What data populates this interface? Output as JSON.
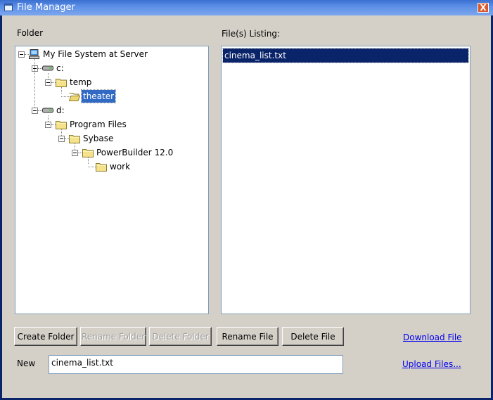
{
  "window": {
    "title": "File Manager",
    "close_label": "X"
  },
  "folder_panel": {
    "label": "Folder",
    "tree": [
      {
        "label": "My File System at Server",
        "icon": "computer-icon",
        "level": 0,
        "expanded": true,
        "selected": false
      },
      {
        "label": "c:",
        "icon": "drive-icon",
        "level": 1,
        "expanded": true,
        "selected": false
      },
      {
        "label": "temp",
        "icon": "folder-icon",
        "level": 2,
        "expanded": true,
        "selected": false
      },
      {
        "label": "theater",
        "icon": "folder-open-icon",
        "level": 3,
        "expanded": false,
        "selected": true
      },
      {
        "label": "d:",
        "icon": "drive-icon",
        "level": 1,
        "expanded": true,
        "selected": false
      },
      {
        "label": "Program Files",
        "icon": "folder-icon",
        "level": 2,
        "expanded": true,
        "selected": false
      },
      {
        "label": "Sybase",
        "icon": "folder-icon",
        "level": 3,
        "expanded": true,
        "selected": false
      },
      {
        "label": "PowerBuilder 12.0",
        "icon": "folder-icon",
        "level": 4,
        "expanded": true,
        "selected": false
      },
      {
        "label": "work",
        "icon": "folder-icon",
        "level": 5,
        "expanded": false,
        "selected": false
      }
    ]
  },
  "files_panel": {
    "label": "File(s) Listing:",
    "files": [
      {
        "name": "cinema_list.txt",
        "selected": true
      }
    ]
  },
  "buttons": {
    "create_folder": "Create Folder",
    "rename_folder": "Rename Folder",
    "delete_folder": "Delete Folder",
    "rename_file": "Rename File",
    "delete_file": "Delete File"
  },
  "new_name": {
    "label": "New",
    "value": "cinema_list.txt"
  },
  "links": {
    "download": "Download File",
    "upload": "Upload Files..."
  },
  "colors": {
    "selection": "#0a246a",
    "tree_selection": "#316ac5",
    "link": "#0000ee",
    "titlebar": "#3a6fd0"
  }
}
